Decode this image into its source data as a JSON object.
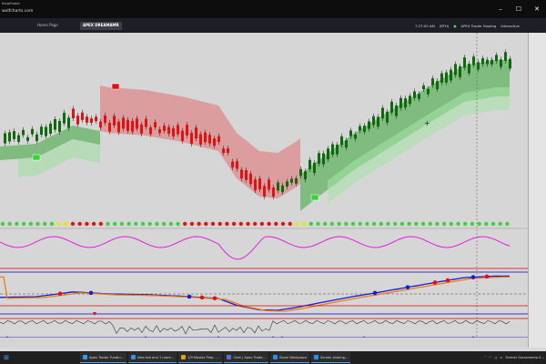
{
  "window": {
    "app_title": "NinjaTrader",
    "url_fragment": "wolfcharts.com"
  },
  "tabs": [
    "",
    "Home Page",
    "APEX DREAMAMR"
  ],
  "toolbar": {
    "time": "7:27:00 AM",
    "session": "(RTH)",
    "hosting": "APEX Trader Hosting",
    "mode": "Interactive"
  },
  "chart": {
    "status_line": ""
  },
  "time_axis": [
    "",
    "",
    "",
    "",
    "",
    "",
    "",
    ""
  ],
  "taskbar": [
    "Apex Trader Fundin...",
    "New tab and 1 more...",
    "1/9 Master Prop - ...",
    "Chat | Apex Trade...",
    "Zoom Workplace",
    "Screen sharing..."
  ],
  "tray": {
    "notification": "Former Sacramento K..."
  },
  "colors": {
    "bull": "#0d6b0d",
    "bear": "#e21212",
    "cloud_green": "#3aa83a",
    "cloud_red": "#e07070",
    "magenta": "#e21ee0",
    "oscillator_blue": "#1a1ad0",
    "oscillator_orange": "#f07c10"
  },
  "icons": [
    "minimize-icon",
    "maximize-icon",
    "close-icon",
    "windows-start-icon",
    "wifi-icon",
    "volume-icon",
    "battery-icon"
  ]
}
